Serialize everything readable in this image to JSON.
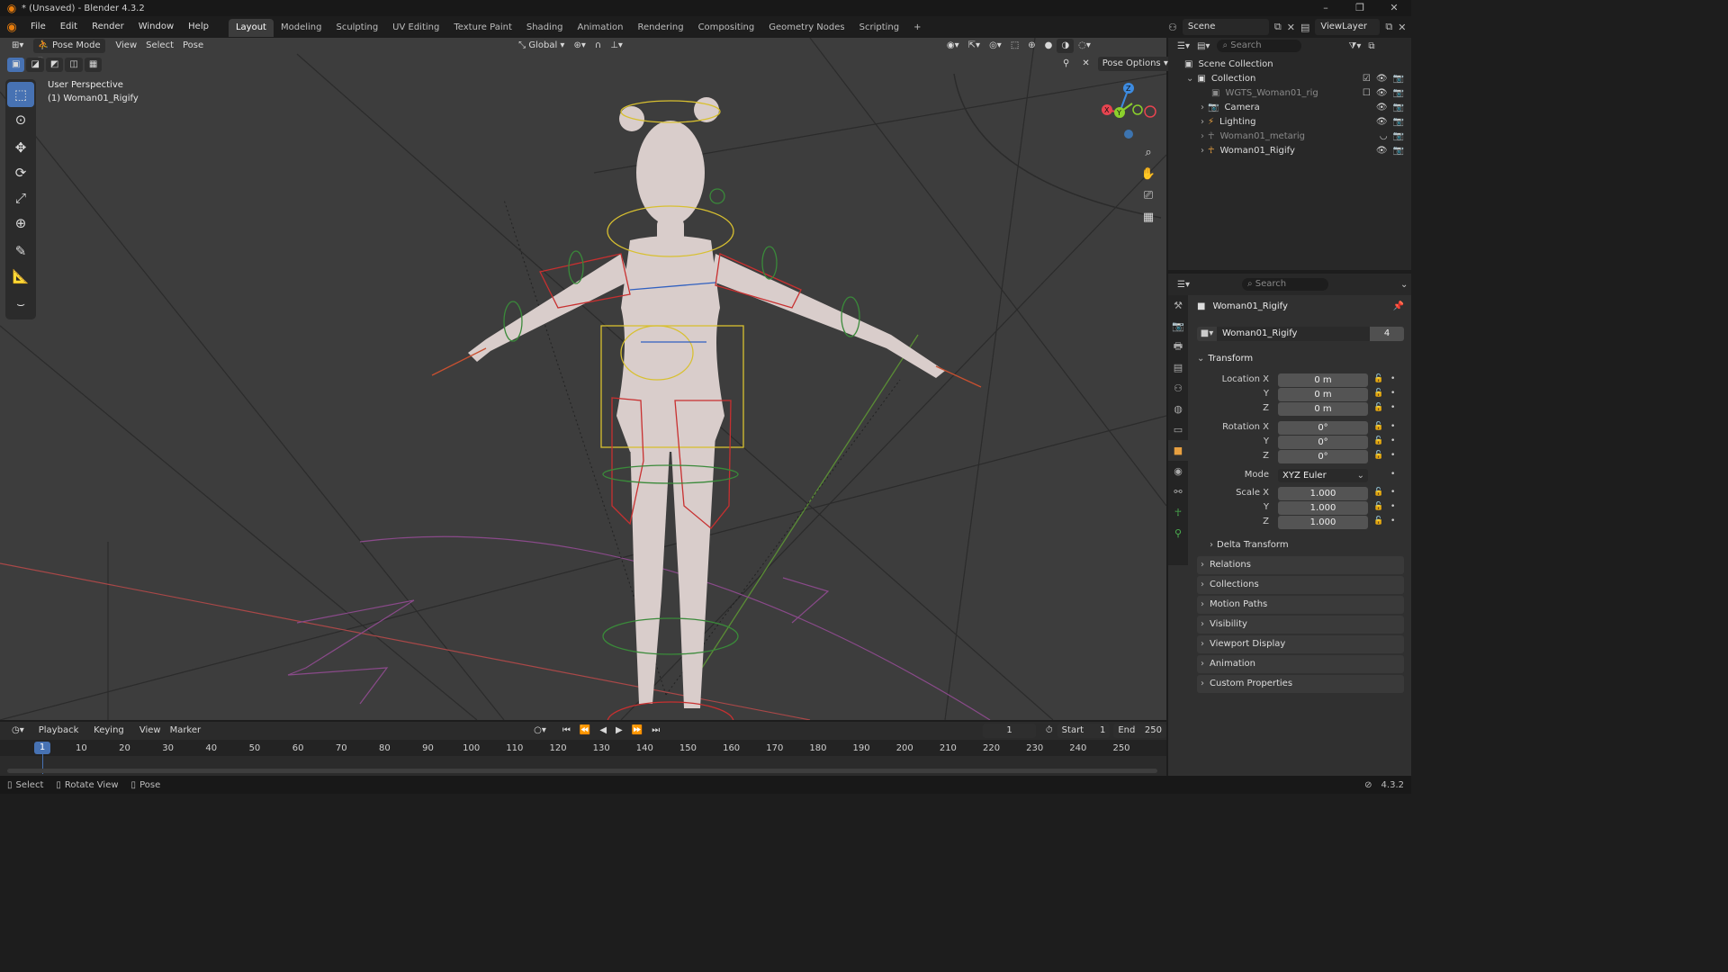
{
  "window": {
    "title": "* (Unsaved) - Blender 4.3.2"
  },
  "menubar": {
    "items": [
      "File",
      "Edit",
      "Render",
      "Window",
      "Help"
    ],
    "workspaces": [
      "Layout",
      "Modeling",
      "Sculpting",
      "UV Editing",
      "Texture Paint",
      "Shading",
      "Animation",
      "Rendering",
      "Compositing",
      "Geometry Nodes",
      "Scripting"
    ],
    "active_workspace": "Layout",
    "add_tab": "+",
    "scene": "Scene",
    "view_layer": "ViewLayer"
  },
  "viewport_header": {
    "mode": "Pose Mode",
    "menus": [
      "View",
      "Select",
      "Pose"
    ],
    "transform_orientation": "Global",
    "pose_options": "Pose Options"
  },
  "viewport_overlay": {
    "perspective": "User Perspective",
    "active_object": "(1) Woman01_Rigify",
    "gizmo_axes": [
      "X",
      "Y",
      "Z"
    ]
  },
  "toolbar": {
    "tools": [
      "select-box",
      "cursor",
      "move",
      "rotate",
      "scale",
      "transform",
      "annotate",
      "measure",
      "bone-relax"
    ]
  },
  "outliner": {
    "search_placeholder": "Search",
    "scene_collection": "Scene Collection",
    "items": [
      {
        "name": "Collection",
        "icon": "collection-icon",
        "dim": false
      },
      {
        "name": "WGTS_Woman01_rig",
        "icon": "collection-icon",
        "dim": true
      },
      {
        "name": "Camera",
        "icon": "camera-icon",
        "dim": false
      },
      {
        "name": "Lighting",
        "icon": "light-icon",
        "dim": false
      },
      {
        "name": "Woman01_metarig",
        "icon": "armature-icon",
        "dim": true
      },
      {
        "name": "Woman01_Rigify",
        "icon": "armature-icon",
        "dim": false
      }
    ]
  },
  "properties": {
    "search_placeholder": "Search",
    "object_name": "Woman01_Rigify",
    "data_name": "Woman01_Rigify",
    "users": "4",
    "transform_header": "Transform",
    "location_label": "Location X",
    "rotation_label": "Rotation X",
    "scale_label": "Scale X",
    "axis_y": "Y",
    "axis_z": "Z",
    "location": [
      "0 m",
      "0 m",
      "0 m"
    ],
    "rotation": [
      "0°",
      "0°",
      "0°"
    ],
    "mode_label": "Mode",
    "mode_value": "XYZ Euler",
    "scale": [
      "1.000",
      "1.000",
      "1.000"
    ],
    "delta_transform": "Delta Transform",
    "panels": [
      "Relations",
      "Collections",
      "Motion Paths",
      "Visibility",
      "Viewport Display",
      "Animation",
      "Custom Properties"
    ]
  },
  "timeline": {
    "menus": [
      "Playback",
      "Keying",
      "View",
      "Marker"
    ],
    "current_frame": "1",
    "start_label": "Start",
    "start": "1",
    "end_label": "End",
    "end": "250",
    "frame_marks": [
      "10",
      "20",
      "30",
      "40",
      "50",
      "60",
      "70",
      "80",
      "90",
      "100",
      "110",
      "120",
      "130",
      "140",
      "150",
      "160",
      "170",
      "180",
      "190",
      "200",
      "210",
      "220",
      "230",
      "240",
      "250"
    ]
  },
  "statusbar": {
    "hints": [
      "Select",
      "Rotate View",
      "Pose"
    ],
    "version": "4.3.2"
  },
  "colors": {
    "accent": "#4772b3",
    "active_frame": "#4772b3",
    "blender_orange": "#e87d0d",
    "axis_x": "#e84450",
    "axis_y": "#8bd02c",
    "axis_z": "#3d8be0"
  }
}
